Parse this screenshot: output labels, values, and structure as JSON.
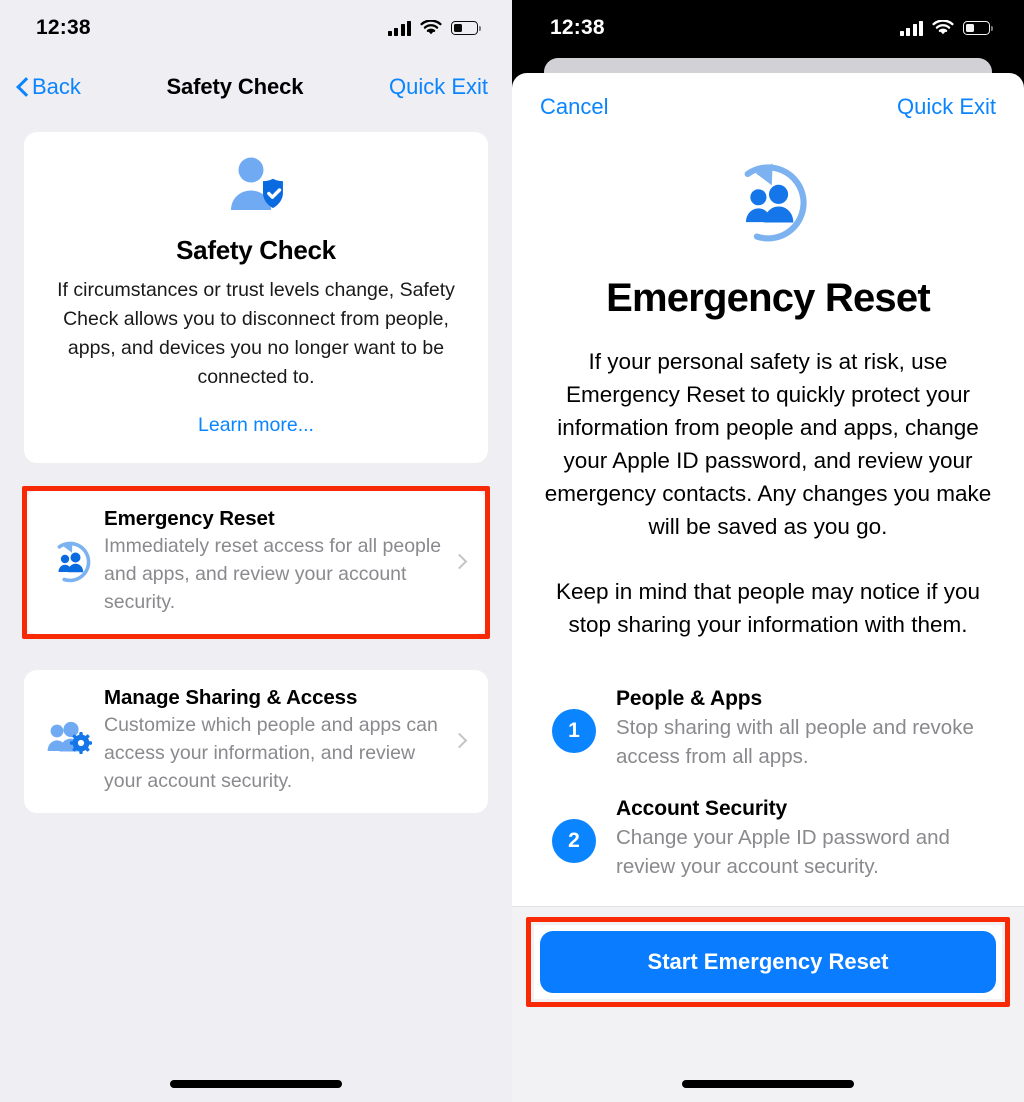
{
  "left_screen": {
    "status_bar": {
      "time": "12:38",
      "cellular_icon": "cellular-bars-icon",
      "wifi_icon": "wifi-icon",
      "battery_icon": "battery-low-icon"
    },
    "nav": {
      "back_label": "Back",
      "title": "Safety Check",
      "quick_exit_label": "Quick Exit"
    },
    "hero_card": {
      "icon": "person-with-shield-check-icon",
      "title": "Safety Check",
      "body": "If circumstances or trust levels change, Safety Check allows you to disconnect from people, apps, and devices you no longer want to be connected to.",
      "learn_more_label": "Learn more..."
    },
    "rows": [
      {
        "icon": "emergency-reset-icon",
        "title": "Emergency Reset",
        "subtitle": "Immediately reset access for all people and apps, and review your account security.",
        "highlighted": true
      },
      {
        "icon": "manage-sharing-gear-icon",
        "title": "Manage Sharing & Access",
        "subtitle": "Customize which people and apps can access your information, and review your account security.",
        "highlighted": false
      }
    ]
  },
  "right_screen": {
    "status_bar": {
      "time": "12:38",
      "cellular_icon": "cellular-bars-icon",
      "wifi_icon": "wifi-icon",
      "battery_icon": "battery-low-icon"
    },
    "sheet_nav": {
      "cancel_label": "Cancel",
      "quick_exit_label": "Quick Exit"
    },
    "hero": {
      "icon": "emergency-reset-icon",
      "title": "Emergency Reset",
      "paragraph_1": "If your personal safety is at risk, use Emergency Reset to quickly protect your information from people and apps, change your Apple ID password, and review your emergency contacts. Any changes you make will be saved as you go.",
      "paragraph_2": "Keep in mind that people may notice if you stop sharing your information with them."
    },
    "steps": [
      {
        "number": "1",
        "title": "People & Apps",
        "description": "Stop sharing with all people and revoke access from all apps."
      },
      {
        "number": "2",
        "title": "Account Security",
        "description": "Change your Apple ID password and review your account security."
      }
    ],
    "footer": {
      "cta_label": "Start Emergency Reset",
      "cta_highlighted": true
    }
  },
  "colors": {
    "accent_blue": "#0a84ff",
    "button_blue": "#0a7cff",
    "highlight_red": "#f82a06",
    "page_background": "#efeef3",
    "card_white": "#ffffff",
    "secondary_text": "#8a8a8e"
  }
}
